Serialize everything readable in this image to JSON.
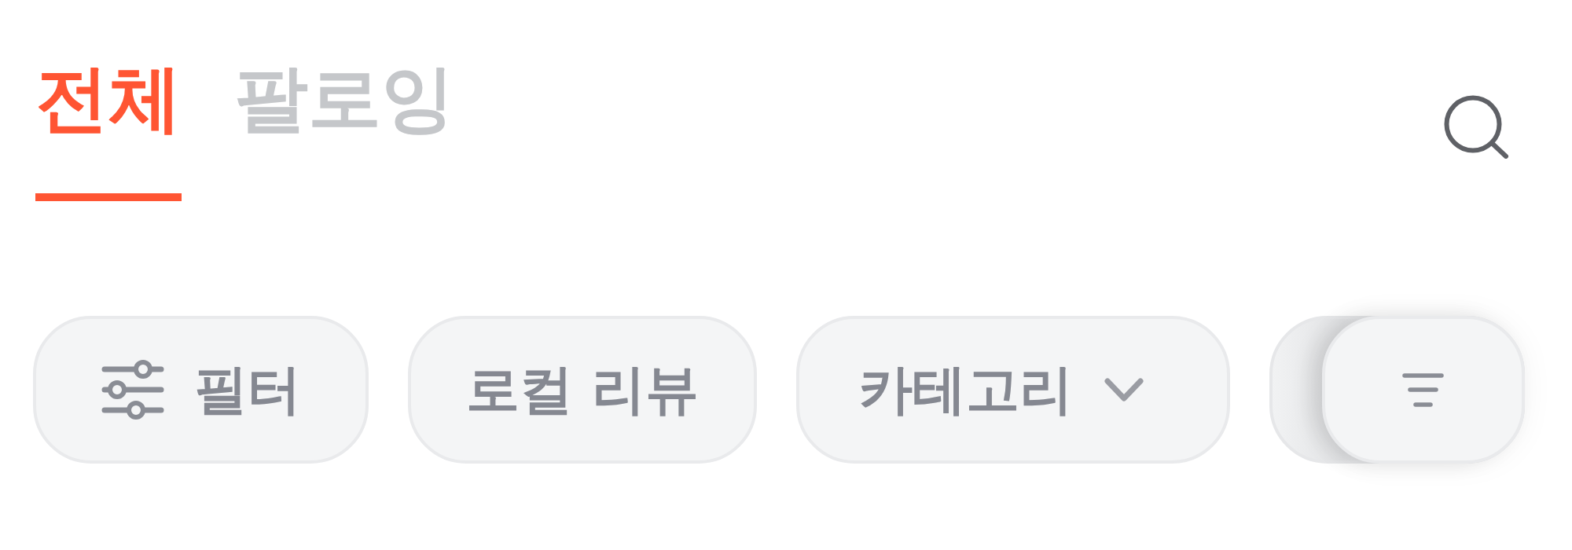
{
  "tabs": [
    {
      "label": "전체",
      "selected": true
    },
    {
      "label": "팔로잉",
      "selected": false
    }
  ],
  "chips": [
    {
      "kind": "filter",
      "label": "필터"
    },
    {
      "kind": "plain",
      "label": "로컬 리뷰"
    },
    {
      "kind": "dropdown",
      "label": "카테고리"
    },
    {
      "kind": "sort"
    }
  ]
}
